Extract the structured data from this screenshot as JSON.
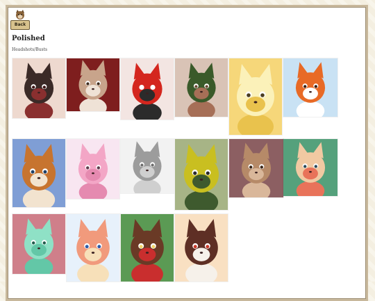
{
  "nav": {
    "back_label": "Back",
    "back_icon": "character-head-icon"
  },
  "gallery": {
    "title": "Polished",
    "subtitle": "Headshots/Busts",
    "items": [
      {
        "bg": "#eed9cf",
        "fur": "#3b2a27",
        "accent": "#8a2f2f",
        "eye": "#3b1414"
      },
      {
        "bg": "#7e1e1e",
        "fur": "#c8a48b",
        "accent": "#efe2d6",
        "eye": "#3e2a1c"
      },
      {
        "bg": "#f3e5e2",
        "fur": "#d4261e",
        "accent": "#2b2b2b",
        "eye": "#ffffff"
      },
      {
        "bg": "#d9c3b6",
        "fur": "#3a5a2a",
        "accent": "#a66f57",
        "eye": "#6a4a33"
      },
      {
        "bg": "#f6d77a",
        "fur": "#fbf1b9",
        "accent": "#e9c24d",
        "eye": "#4a3d20"
      },
      {
        "bg": "#c9e2f4",
        "fur": "#e86a26",
        "accent": "#ffffff",
        "eye": "#3c1f12"
      },
      {
        "bg": "#7f9ed5",
        "fur": "#c7742f",
        "accent": "#f2e3cf",
        "eye": "#1e3f66"
      },
      {
        "bg": "#f8e6f1",
        "fur": "#f3a6c6",
        "accent": "#e58ab0",
        "eye": "#5b3a4a"
      },
      {
        "bg": "#f2f2f2",
        "fur": "#9c9c9c",
        "accent": "#cfcfcf",
        "eye": "#6c6c6c"
      },
      {
        "bg": "#a7b486",
        "fur": "#c9bf20",
        "accent": "#3e5a2e",
        "eye": "#2a2a2a"
      },
      {
        "bg": "#8c5f62",
        "fur": "#b68a68",
        "accent": "#d9b79a",
        "eye": "#3a2618"
      },
      {
        "bg": "#55a17c",
        "fur": "#f1c9a2",
        "accent": "#e8735a",
        "eye": "#2b4a5a"
      },
      {
        "bg": "#cf7f8a",
        "fur": "#8fe1c6",
        "accent": "#63c7a7",
        "eye": "#1f5a4a"
      },
      {
        "bg": "#e7f1fb",
        "fur": "#f19a7c",
        "accent": "#f7e0b9",
        "eye": "#2d5ba8"
      },
      {
        "bg": "#5b9a54",
        "fur": "#6a3a26",
        "accent": "#c92e2e",
        "eye": "#f1d36a"
      },
      {
        "bg": "#f9e0c2",
        "fur": "#5e2f25",
        "accent": "#f6f1ea",
        "eye": "#c73a2a"
      }
    ]
  }
}
